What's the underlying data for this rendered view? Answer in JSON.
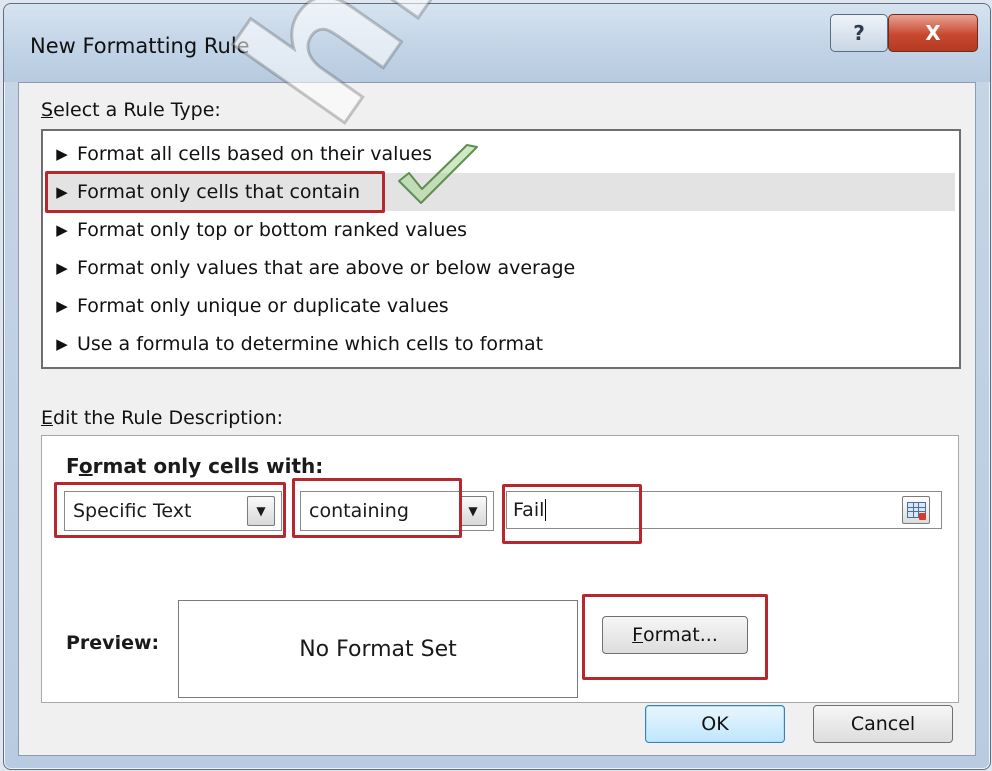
{
  "dialog": {
    "title": "New Formatting Rule",
    "help_label": "?",
    "close_label": "X"
  },
  "rule_type": {
    "label_access_key": "S",
    "label_rest": "elect a Rule Type:",
    "items": [
      {
        "label": "Format all cells based on their values",
        "selected": false
      },
      {
        "label": "Format only cells that contain",
        "selected": true
      },
      {
        "label": "Format only top or bottom ranked values",
        "selected": false
      },
      {
        "label": "Format only values that are above or below average",
        "selected": false
      },
      {
        "label": "Format only unique or duplicate values",
        "selected": false
      },
      {
        "label": "Use a formula to determine which cells to format",
        "selected": false
      }
    ]
  },
  "description": {
    "label_access_key": "E",
    "label_rest": "dit the Rule Description:",
    "heading_pre": "F",
    "heading_access_key": "o",
    "heading_post": "rmat only cells with:",
    "condition_type": "Specific Text",
    "operator": "containing",
    "value": "Fail"
  },
  "preview": {
    "label": "Preview:",
    "sample_text": "No Format Set",
    "format_button_access_key": "F",
    "format_button_rest": "ormat..."
  },
  "footer": {
    "ok_label": "OK",
    "cancel_label": "Cancel"
  },
  "annotation_color": "#b8272d",
  "watermark_text": "hiratg.ru"
}
